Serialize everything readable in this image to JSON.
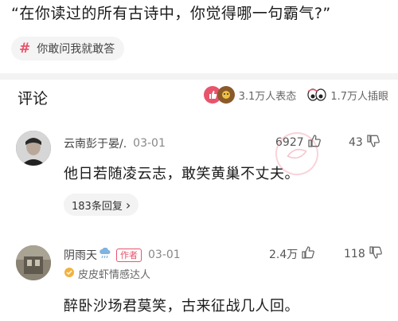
{
  "question": "“在你读过的所有古诗中，你觉得哪一句霸气?”",
  "topic": {
    "hash": "#",
    "label": "你敢问我就敢答"
  },
  "comments_section": {
    "title": "评论",
    "reactions": {
      "expressed": "3.1万人表态",
      "illustrated": "1.7万人插眼"
    }
  },
  "comments": [
    {
      "user": "云南彭于晏/.",
      "date": "03-01",
      "likes": "6927",
      "dislikes": "43",
      "text": "他日若随凌云志，敢笑黄巢不丈夫。",
      "replies_label": "183条回复",
      "replies_arrow": "›"
    },
    {
      "user": "阴雨天",
      "badge_icon": "cloud-rain-icon",
      "author_tag": "作者",
      "date": "03-01",
      "likes": "2.4万",
      "dislikes": "118",
      "sub_tag": "皮皮虾情感达人",
      "text": "醉卧沙场君莫笑，古来征战几人回。"
    }
  ],
  "colors": {
    "accent": "#e8546c",
    "background": "#ffffff",
    "band": "#f3f3f3"
  }
}
